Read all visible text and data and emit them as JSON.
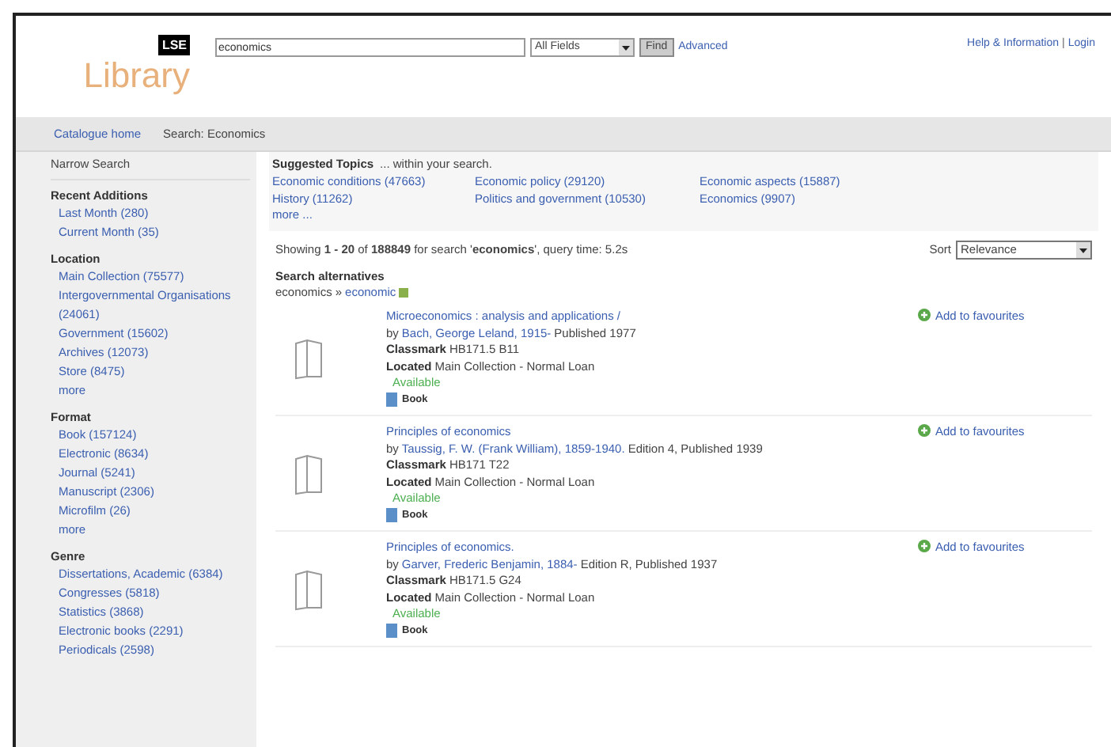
{
  "header": {
    "logo_mark": "LSE",
    "logo_text": "Library",
    "search": {
      "value": "economics"
    },
    "field_select": "All Fields",
    "find_button": "Find",
    "advanced_link": "Advanced",
    "top_links": [
      "Help & Information",
      "Login"
    ],
    "separator": "|"
  },
  "nav": {
    "home_link": "Catalogue home",
    "breadcrumb": "Search: Economics"
  },
  "sidebar": {
    "title": "Narrow Search",
    "groups": [
      {
        "heading": "Recent Additions",
        "items": [
          "Last Month (280)",
          "Current Month (35)"
        ]
      },
      {
        "heading": "Location",
        "items": [
          "Main Collection (75577)",
          "Intergovernmental Organisations (24061)",
          "Government (15602)",
          "Archives (12073)",
          "Store (8475)",
          "more"
        ]
      },
      {
        "heading": "Format",
        "items": [
          "Book (157124)",
          "Electronic (8634)",
          "Journal (5241)",
          "Manuscript (2306)",
          "Microfilm (26)",
          "more"
        ]
      },
      {
        "heading": "Genre",
        "items": [
          "Dissertations, Academic (6384)",
          "Congresses (5818)",
          "Statistics (3868)",
          "Electronic books (2291)",
          "Periodicals (2598)"
        ]
      }
    ]
  },
  "suggested": {
    "title": "Suggested Topics",
    "note": "... within your search.",
    "topics": [
      "Economic conditions (47663)",
      "Economic policy (29120)",
      "Economic aspects (15887)",
      "History (11262)",
      "Politics and government (10530)",
      "Economics (9907)"
    ],
    "more": "more ..."
  },
  "summary": "Showing **1 - 20** of **188849** for search '**economics**', query time: 5.2s",
  "sort": {
    "label": "Sort",
    "value": "Relevance"
  },
  "alternatives": {
    "title": "Search alternatives",
    "from": "economics",
    "arrow": "»",
    "to": "economic"
  },
  "results": [
    {
      "title": "Microeconomics : analysis and applications /",
      "by": "by",
      "author": "Bach, George Leland, 1915-",
      "published": "Published 1977",
      "classmark_label": "Classmark",
      "located_label": "Located",
      "classmark": "HB171.5 B11",
      "located": "Main Collection - Normal Loan",
      "status": "Available",
      "format": "Book",
      "favourite": "Add to favourites"
    },
    {
      "title": "Principles of economics",
      "by": "by",
      "author": "Taussig, F. W. (Frank William), 1859-1940.",
      "published": "Edition 4, Published 1939",
      "classmark_label": "Classmark",
      "located_label": "Located",
      "classmark": "HB171 T22",
      "located": "Main Collection - Normal Loan",
      "status": "Available",
      "format": "Book",
      "favourite": "Add to favourites"
    },
    {
      "title": "Principles of economics.",
      "by": "by",
      "author": "Garver, Frederic Benjamin, 1884-",
      "published": "Edition R, Published 1937",
      "classmark_label": "Classmark",
      "located_label": "Located",
      "classmark": "HB171.5 G24",
      "located": "Main Collection - Normal Loan",
      "status": "Available",
      "format": "Book",
      "favourite": "Add to favourites"
    }
  ]
}
